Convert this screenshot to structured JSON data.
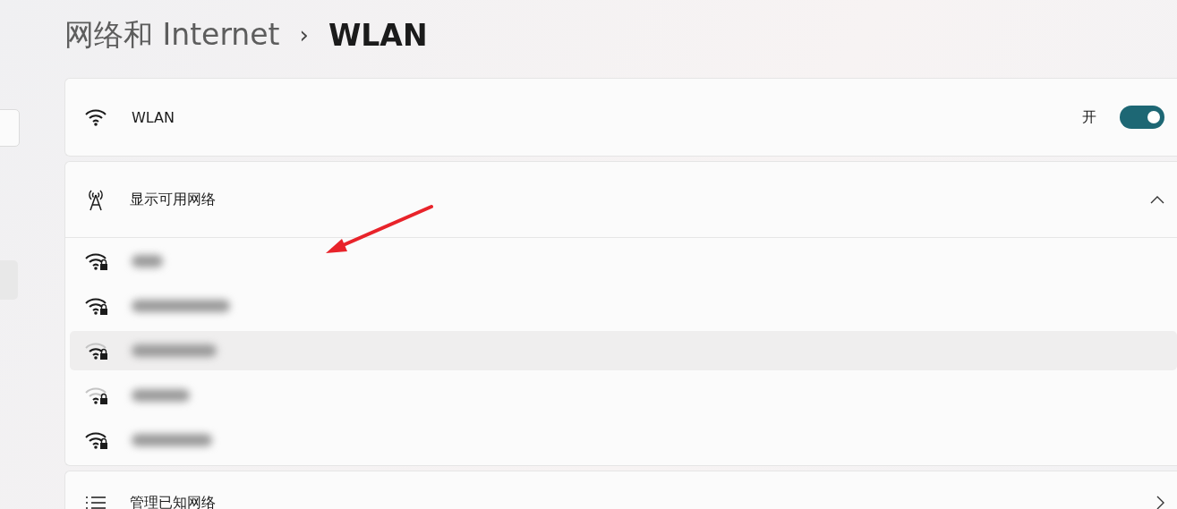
{
  "breadcrumb": {
    "parent": "网络和 Internet",
    "separator": "›",
    "current": "WLAN"
  },
  "wlan": {
    "label": "WLAN",
    "state_label": "开",
    "on": true
  },
  "available": {
    "label": "显示可用网络",
    "expanded": true,
    "networks": [
      {
        "kind": "full",
        "secured": true,
        "selected": false
      },
      {
        "kind": "full",
        "secured": true,
        "selected": false
      },
      {
        "kind": "medium",
        "secured": true,
        "selected": true
      },
      {
        "kind": "weak",
        "secured": true,
        "selected": false
      },
      {
        "kind": "full",
        "secured": true,
        "selected": false
      }
    ]
  },
  "known": {
    "label": "管理已知网络"
  }
}
